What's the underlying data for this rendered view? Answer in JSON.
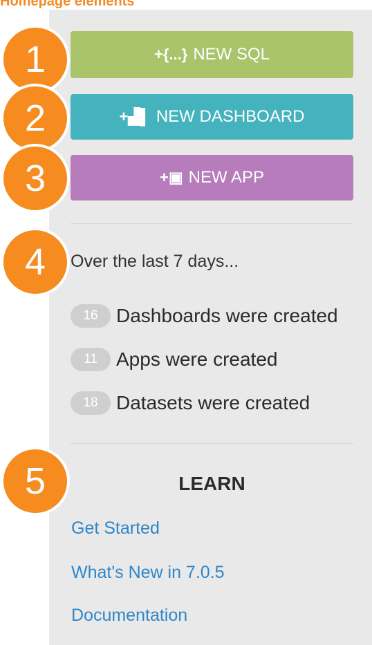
{
  "page": {
    "title": "Homepage elements"
  },
  "actions": {
    "new_sql": {
      "icon": "+{...}",
      "label": "NEW SQL"
    },
    "new_dashboard": {
      "icon": "+▟▌",
      "label": "NEW DASHBOARD"
    },
    "new_app": {
      "icon": "+▣",
      "label": "NEW APP"
    }
  },
  "callouts": [
    "1",
    "2",
    "3",
    "4",
    "5"
  ],
  "stats": {
    "intro": "Over the last 7 days...",
    "items": [
      {
        "count": "16",
        "label": "Dashboards were created"
      },
      {
        "count": "11",
        "label": "Apps were created"
      },
      {
        "count": "18",
        "label": "Datasets were created"
      }
    ]
  },
  "learn": {
    "heading": "LEARN",
    "links": [
      {
        "label": "Get Started"
      },
      {
        "label": "What's New in 7.0.5"
      },
      {
        "label": "Documentation"
      }
    ]
  },
  "colors": {
    "callout": "#f68b1f",
    "new_sql": "#a9c46a",
    "new_dashboard": "#45b3be",
    "new_app": "#b67cbc",
    "link": "#2f86c8"
  }
}
